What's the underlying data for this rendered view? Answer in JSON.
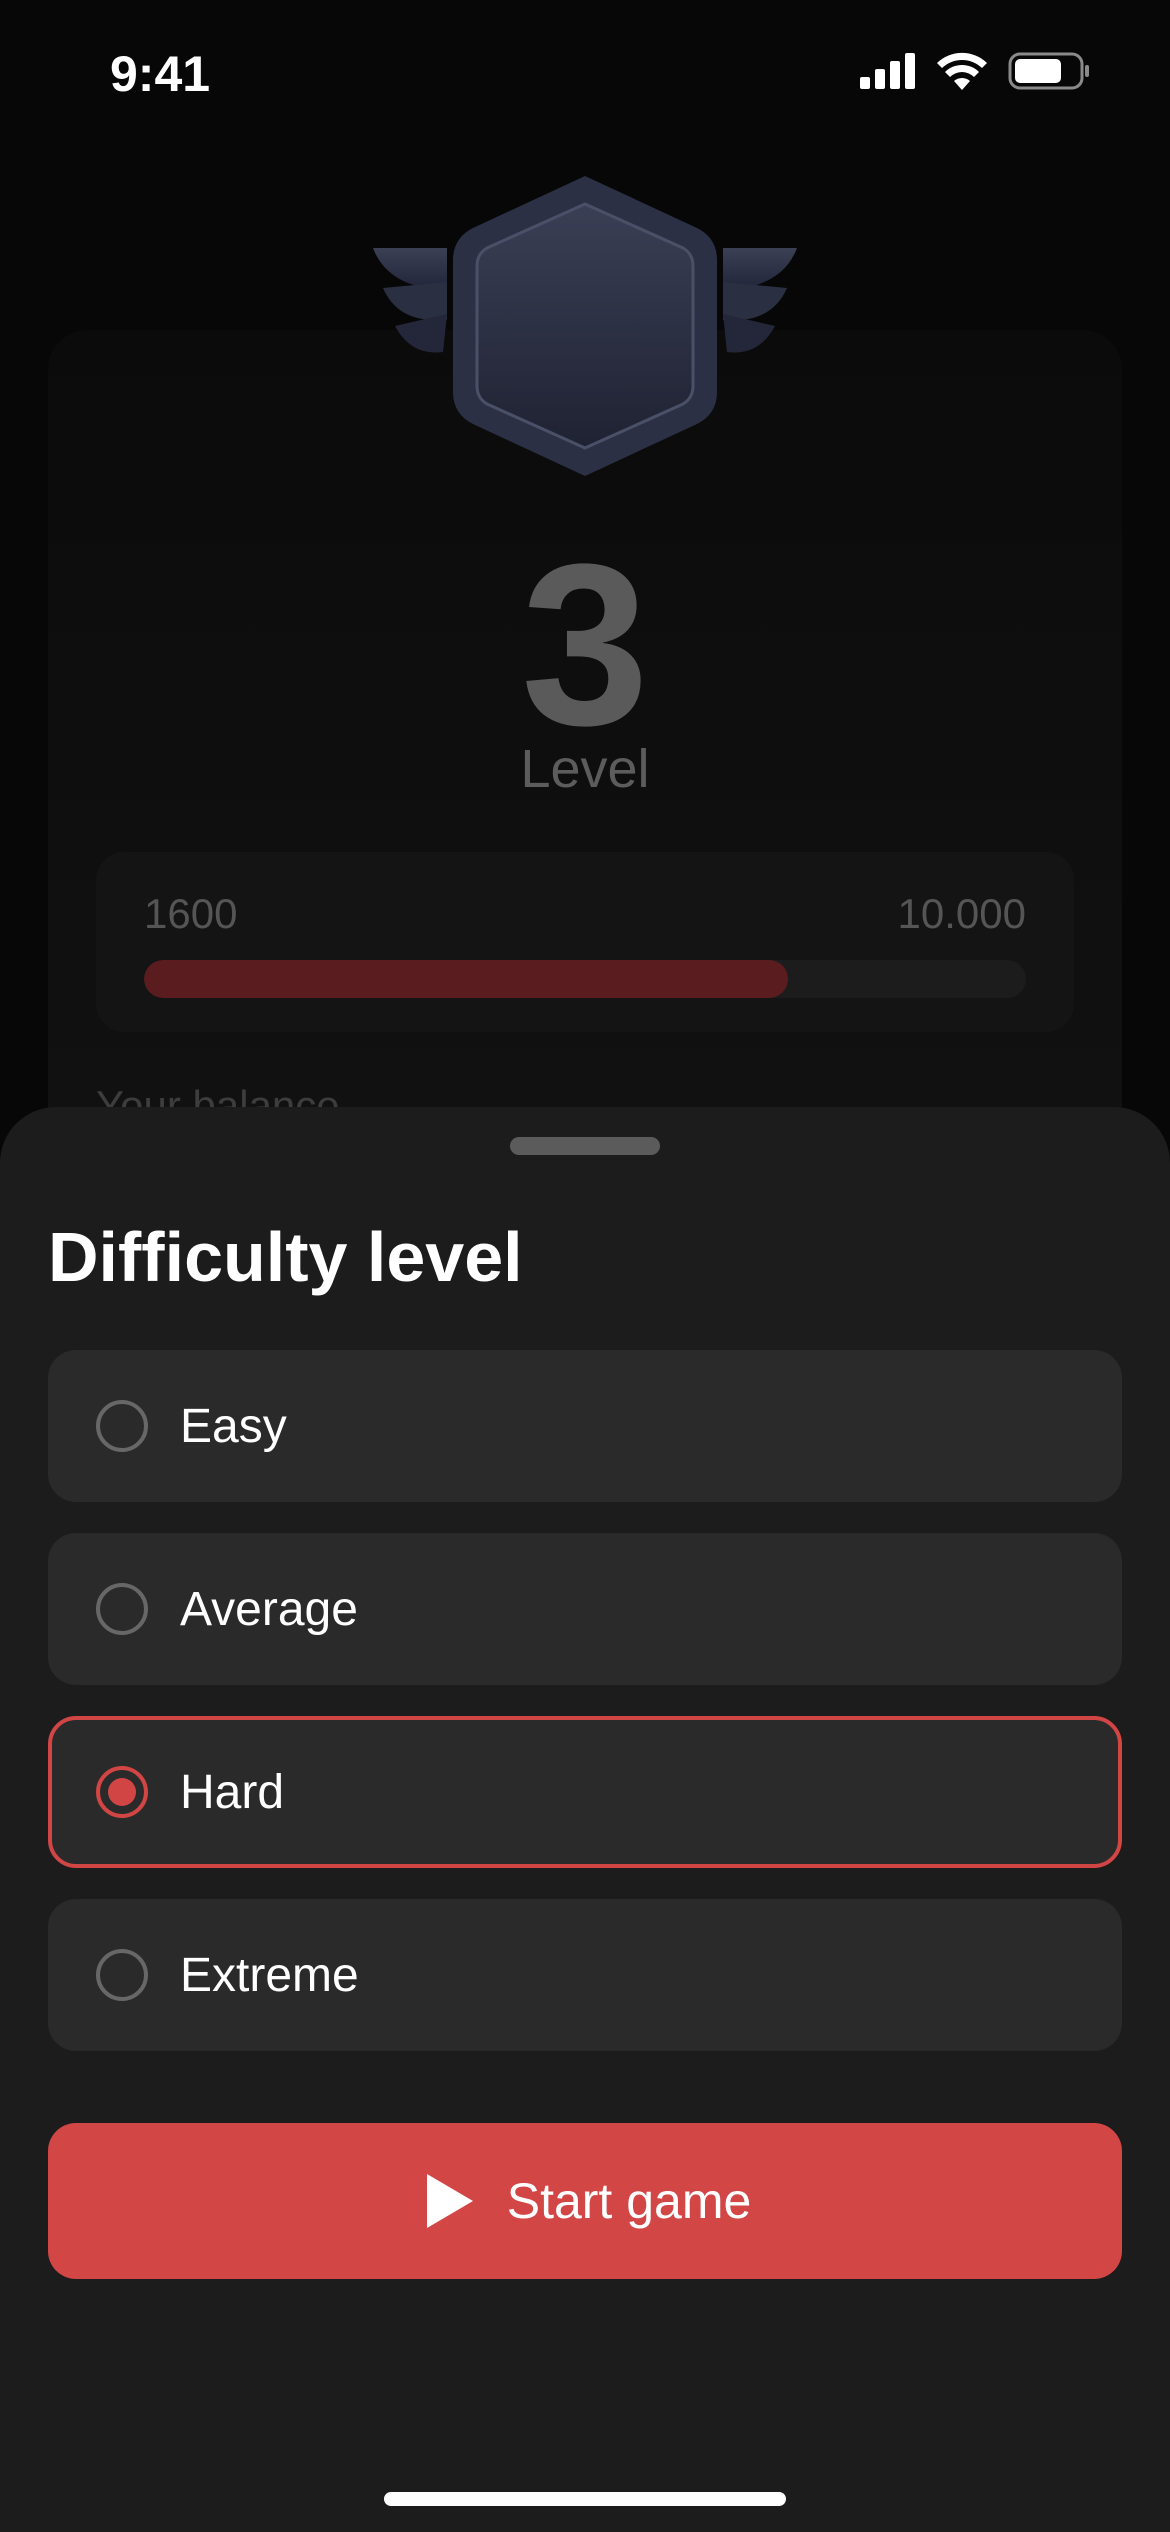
{
  "status_bar": {
    "time": "9:41",
    "icons": [
      "cellular-signal-icon",
      "wifi-icon",
      "battery-icon"
    ]
  },
  "level_screen": {
    "badge_icon": "winged-hexagon-badge-icon",
    "level_number": "3",
    "level_label": "Level",
    "progress": {
      "min_label": "1600",
      "max_label": "10.000",
      "fill_fraction": 0.73
    },
    "balance_label": "Your balance"
  },
  "sheet": {
    "title": "Difficulty level",
    "options": [
      {
        "label": "Easy",
        "selected": false
      },
      {
        "label": "Average",
        "selected": false
      },
      {
        "label": "Hard",
        "selected": true
      },
      {
        "label": "Extreme",
        "selected": false
      }
    ],
    "start_button": {
      "label": "Start game",
      "icon": "play-icon"
    }
  },
  "colors": {
    "accent": "#d34646",
    "sheet_background": "#1c1c1c",
    "option_background": "#2a2a2a"
  }
}
